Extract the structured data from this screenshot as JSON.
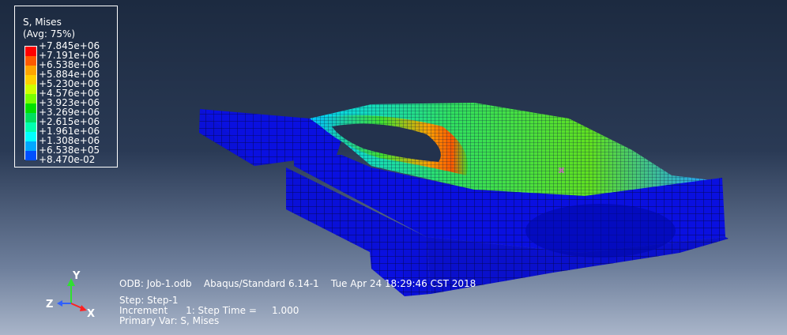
{
  "legend": {
    "title": "S, Mises",
    "subtitle": "(Avg: 75%)",
    "labels": [
      "+7.845e+06",
      "+7.191e+06",
      "+6.538e+06",
      "+5.884e+06",
      "+5.230e+06",
      "+4.576e+06",
      "+3.923e+06",
      "+3.269e+06",
      "+2.615e+06",
      "+1.961e+06",
      "+1.308e+06",
      "+6.538e+05",
      "+8.470e-02"
    ],
    "colors": [
      "#ff0000",
      "#ff5a00",
      "#ffa500",
      "#ffd000",
      "#d0ff00",
      "#78ff00",
      "#00e000",
      "#00e060",
      "#00ffb0",
      "#00ffff",
      "#00a8ff",
      "#0050ff",
      "#0000ff"
    ]
  },
  "info": {
    "line1": "ODB: Job-1.odb    Abaqus/Standard 6.14-1    Tue Apr 24 18:29:46 CST 2018",
    "line2": "Step: Step-1",
    "line3": "Increment      1: Step Time =     1.000",
    "line4": "Primary Var: S, Mises"
  },
  "triad": {
    "x": "X",
    "y": "Y",
    "z": "Z",
    "x_color": "#ff2020",
    "y_color": "#30e030",
    "z_color": "#3060ff"
  },
  "model_colors": {
    "base": "#0a10e0",
    "edge": "#000a60",
    "mesh": "#05085a"
  }
}
